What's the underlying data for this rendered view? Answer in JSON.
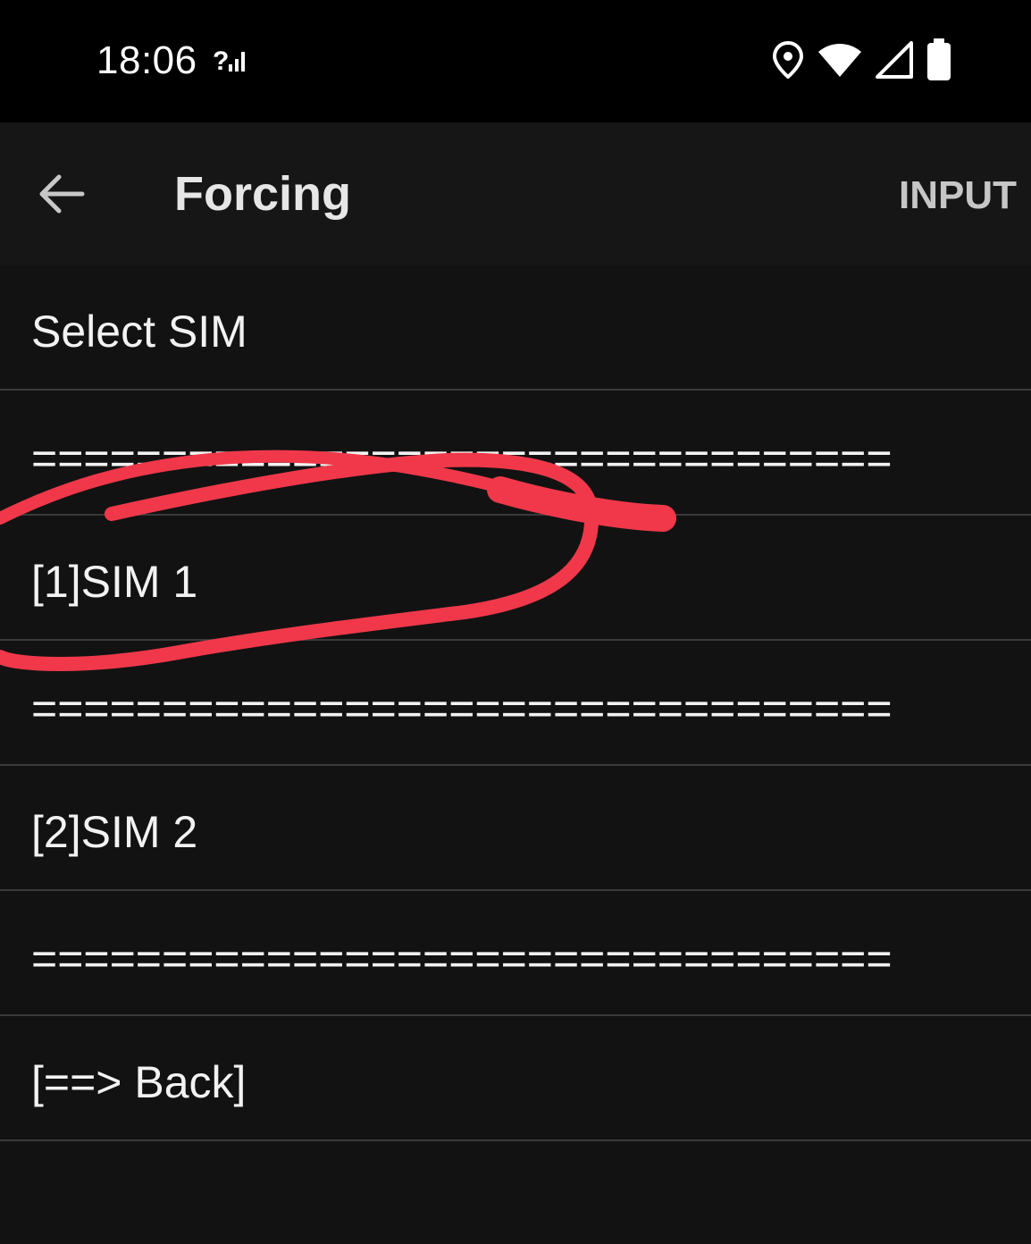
{
  "status_bar": {
    "time": "18:06",
    "icons": [
      "signal-unknown-icon",
      "location-icon",
      "wifi-icon",
      "cell-signal-icon",
      "battery-icon"
    ]
  },
  "app_bar": {
    "back_icon": "back-arrow-icon",
    "title": "Forcing",
    "action_label": "INPUT"
  },
  "menu": {
    "header": "Select SIM",
    "items": [
      {
        "text": "=================================",
        "kind": "separator"
      },
      {
        "text": "[1]SIM 1",
        "kind": "option"
      },
      {
        "text": "=================================",
        "kind": "separator"
      },
      {
        "text": "[2]SIM 2",
        "kind": "option"
      },
      {
        "text": "=================================",
        "kind": "separator"
      },
      {
        "text": "[==> Back]",
        "kind": "option"
      }
    ]
  },
  "colors": {
    "background": "#121212",
    "status_bar": "#000000",
    "divider": "#3a3a3a",
    "annotation_red": "#f0384a"
  }
}
